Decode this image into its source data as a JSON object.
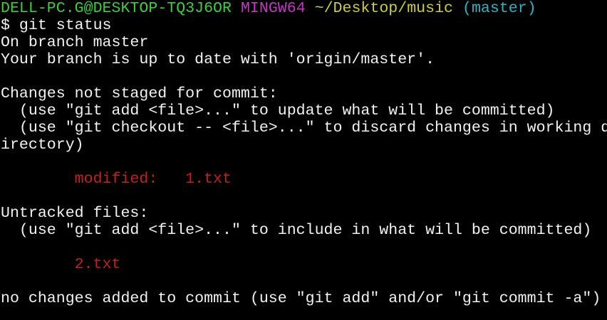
{
  "prompt": {
    "user_host": "DELL-PC.G@DESKTOP-TQ3J6OR",
    "shell": "MINGW64",
    "path": "~/Desktop/music",
    "branch": "(master)"
  },
  "command": "$ git status",
  "output": {
    "branch_line": "On branch master",
    "uptodate_line": "Your branch is up to date with 'origin/master'.",
    "unstaged_header": "Changes not staged for commit:",
    "unstaged_hint1": "  (use \"git add <file>...\" to update what will be committed)",
    "unstaged_hint2": "  (use \"git checkout -- <file>...\" to discard changes in working d",
    "unstaged_hint2_wrap": "irectory)",
    "modified_label": "        modified:   ",
    "modified_file": "1.txt",
    "untracked_header": "Untracked files:",
    "untracked_hint": "  (use \"git add <file>...\" to include in what will be committed)",
    "untracked_file": "        2.txt",
    "summary": "no changes added to commit (use \"git add\" and/or \"git commit -a\")"
  },
  "colors": {
    "background": "#000000",
    "text": "#f2f2f2",
    "user_host": "#3ccf3c",
    "shell": "#c238c2",
    "path": "#cdcd3d",
    "branch": "#2bb6c7",
    "modified": "#c81f1f"
  }
}
